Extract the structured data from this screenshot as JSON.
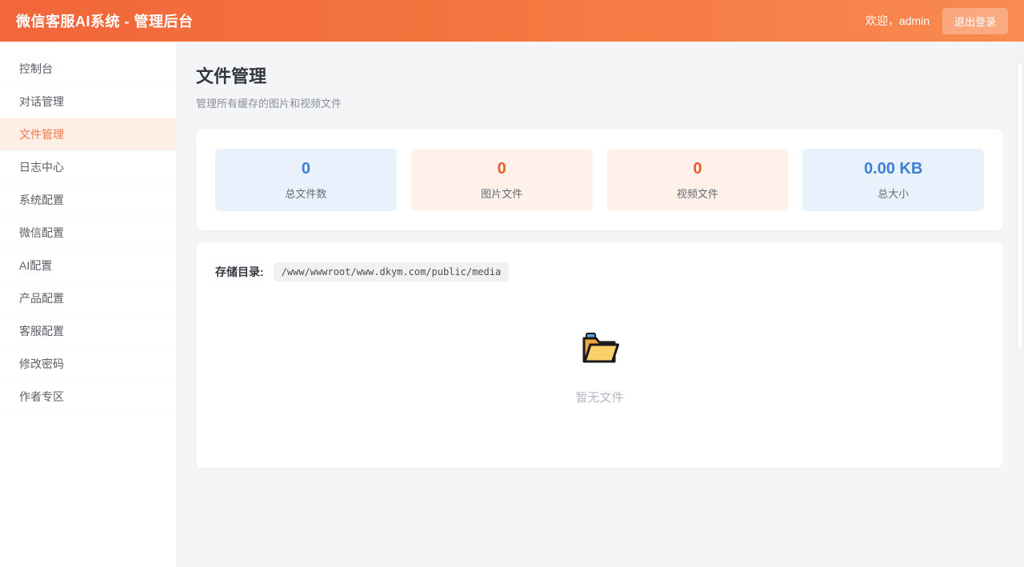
{
  "header": {
    "title": "微信客服AI系统 - 管理后台",
    "welcome": "欢迎，admin",
    "logout_label": "退出登录"
  },
  "sidebar": {
    "items": [
      {
        "label": "控制台",
        "active": false
      },
      {
        "label": "对话管理",
        "active": false
      },
      {
        "label": "文件管理",
        "active": true
      },
      {
        "label": "日志中心",
        "active": false
      },
      {
        "label": "系统配置",
        "active": false
      },
      {
        "label": "微信配置",
        "active": false
      },
      {
        "label": "AI配置",
        "active": false
      },
      {
        "label": "产品配置",
        "active": false
      },
      {
        "label": "客服配置",
        "active": false
      },
      {
        "label": "修改密码",
        "active": false
      },
      {
        "label": "作者专区",
        "active": false
      }
    ]
  },
  "main": {
    "page_title": "文件管理",
    "page_subtitle": "管理所有缓存的图片和视频文件",
    "stats": [
      {
        "value": "0",
        "label": "总文件数",
        "theme": "blue"
      },
      {
        "value": "0",
        "label": "图片文件",
        "theme": "orange"
      },
      {
        "value": "0",
        "label": "视频文件",
        "theme": "orange"
      },
      {
        "value": "0.00 KB",
        "label": "总大小",
        "theme": "blue"
      }
    ],
    "storage": {
      "label": "存储目录:",
      "path": "/www/wwwroot/www.dkym.com/public/media"
    },
    "empty": {
      "icon": "open-folder-icon",
      "text": "暂无文件"
    }
  },
  "colors": {
    "header_gradient_left": "#f1663a",
    "header_gradient_right": "#f98a50",
    "active_item_bg": "#fdeee6",
    "active_item_text": "#f4764a",
    "stat_blue_bg": "#e9f2fc",
    "stat_blue_text": "#3d7fd6",
    "stat_orange_bg": "#fdf1ea",
    "stat_orange_text": "#f05a28",
    "content_bg": "#f4f5f7"
  }
}
